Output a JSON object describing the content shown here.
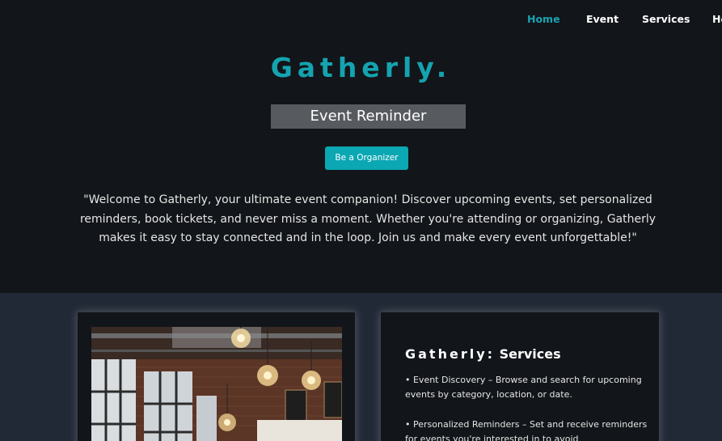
{
  "nav": {
    "items": [
      {
        "label": "Home",
        "active": true
      },
      {
        "label": "Event",
        "active": false
      },
      {
        "label": "Services",
        "active": false
      },
      {
        "label": "He",
        "active": false
      }
    ]
  },
  "hero": {
    "brand": "Gatherly.",
    "subtitle": "Event Reminder",
    "cta_label": "Be a Organizer",
    "welcome": "\"Welcome to Gatherly, your ultimate event companion! Discover upcoming events, set personalized reminders, book tickets, and never miss a moment. Whether you're attending or organizing, Gatherly makes it easy to stay connected and in the loop. Join us and make every event unforgettable!\""
  },
  "services": {
    "title_brand": "Gatherly:",
    "title_rest": "Services",
    "items": [
      "• Event Discovery – Browse and search for upcoming events by category, location, or date.",
      "• Personalized Reminders – Set and receive reminders for events you're interested in to avoid"
    ]
  },
  "colors": {
    "accent": "#15a3b0",
    "button": "#0ba7b3",
    "background": "#121519",
    "section": "#212936"
  }
}
